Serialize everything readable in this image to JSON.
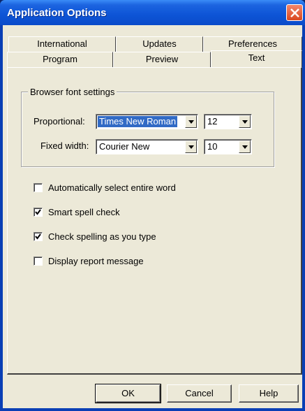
{
  "window": {
    "title": "Application Options"
  },
  "tabs": {
    "row_back": [
      {
        "label": "International"
      },
      {
        "label": "Updates"
      },
      {
        "label": "Preferences"
      }
    ],
    "row_front": [
      {
        "label": "Program"
      },
      {
        "label": "Preview"
      },
      {
        "label": "Text",
        "selected": true
      }
    ]
  },
  "font_settings": {
    "group_title": "Browser font settings",
    "proportional": {
      "label": "Proportional:",
      "font": "Times New Roman",
      "size": "12"
    },
    "fixed_width": {
      "label": "Fixed width:",
      "font": "Courier New",
      "size": "10"
    }
  },
  "options": [
    {
      "label": "Automatically select entire word",
      "checked": false
    },
    {
      "label": "Smart spell check",
      "checked": true
    },
    {
      "label": "Check spelling as you type",
      "checked": true
    },
    {
      "label": "Display report message",
      "checked": false
    }
  ],
  "buttons": {
    "ok": "OK",
    "cancel": "Cancel",
    "help": "Help"
  },
  "icons": {
    "close": "close-icon",
    "dropdown": "chevron-down-icon",
    "check": "checkmark-icon"
  },
  "colors": {
    "titlebar": "#0d54d6",
    "close_button": "#d9471f",
    "selection": "#316ac5",
    "dialog_face": "#ece9d8"
  }
}
